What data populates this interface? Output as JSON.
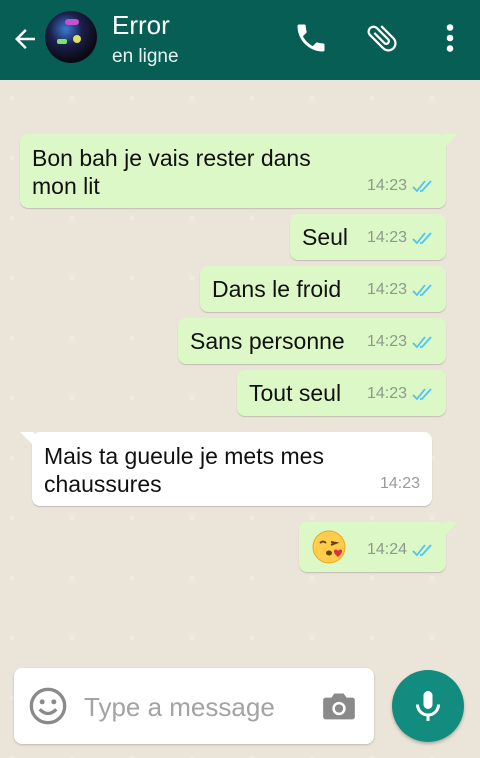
{
  "header": {
    "contact_name": "Error",
    "status": "en ligne",
    "back_icon": "arrow-left-icon",
    "call_icon": "phone-icon",
    "attach_icon": "paperclip-icon",
    "menu_icon": "more-vert-icon",
    "color": "#075e54"
  },
  "messages": [
    {
      "direction": "out",
      "text_line1": "Bon bah je vais rester dans",
      "text_line2": "mon lit",
      "time": "14:23",
      "read": true
    },
    {
      "direction": "out",
      "text": "Seul",
      "time": "14:23",
      "read": true
    },
    {
      "direction": "out",
      "text": "Dans le froid",
      "time": "14:23",
      "read": true
    },
    {
      "direction": "out",
      "text": "Sans personne",
      "time": "14:23",
      "read": true
    },
    {
      "direction": "out",
      "text": "Tout seul",
      "time": "14:23",
      "read": true
    },
    {
      "direction": "in",
      "text_line1": "Mais ta gueule je mets mes",
      "text_line2": "chaussures",
      "time": "14:23"
    },
    {
      "direction": "out",
      "emoji": "kissing-face-with-heart-emoji",
      "time": "14:24",
      "read": true
    }
  ],
  "composer": {
    "placeholder": "Type a message",
    "emoji_icon": "smiley-icon",
    "camera_icon": "camera-icon",
    "mic_icon": "microphone-icon"
  },
  "colors": {
    "outgoing_bubble": "#dcf8c6",
    "incoming_bubble": "#ffffff",
    "read_ticks": "#4fc3f7",
    "mic_button": "#128c7e"
  }
}
